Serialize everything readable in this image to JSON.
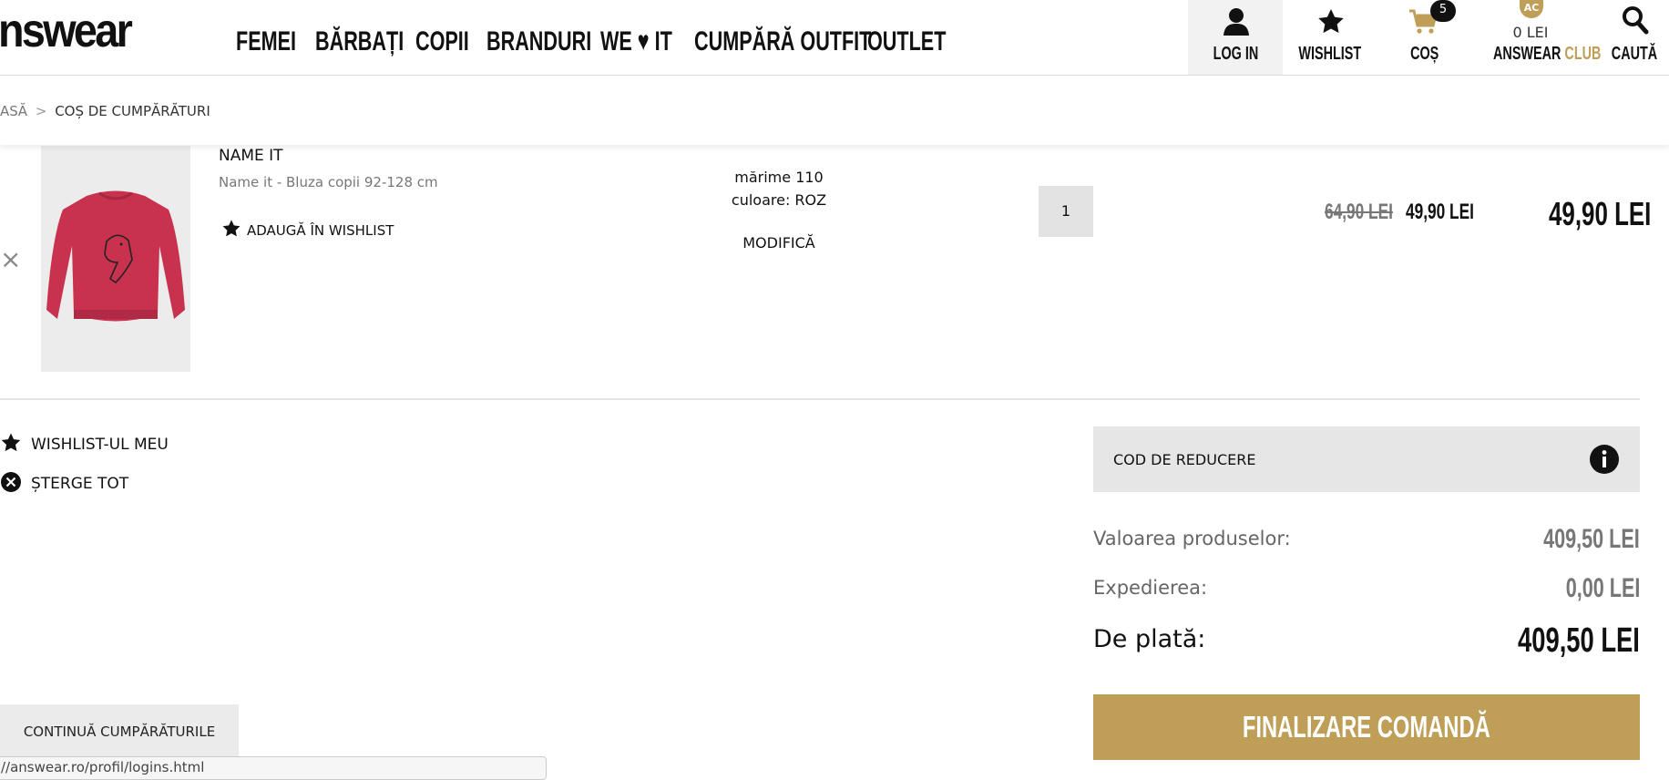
{
  "header": {
    "logo": "nswear",
    "nav": [
      "FEMEI",
      "BĂRBAȚI",
      "COPII",
      "BRANDURI",
      "WE ♥ IT",
      "CUMPĂRĂ OUTFIT",
      "OUTLET"
    ],
    "login_label": "LOG IN",
    "wishlist_label": "WISHLIST",
    "cart_label": "COȘ",
    "cart_count": "5",
    "club_badge": "AC",
    "club_amount": "0 LEI",
    "club_label_1": "ANSWEAR",
    "club_label_2": "CLUB",
    "search_label": "CAUTĂ"
  },
  "breadcrumb": {
    "home": "ASĂ",
    "separator": ">",
    "current": "COȘ DE CUMPĂRĂTURI"
  },
  "cart_item": {
    "brand": "NAME IT",
    "title": "Name it - Bluza copii 92-128 cm",
    "add_wishlist": "ADAUGĂ ÎN WISHLIST",
    "size": "mărime 110",
    "color": "culoare: ROZ",
    "modify": "MODIFICĂ",
    "quantity": "1",
    "old_price": "64,90 LEI",
    "price": "49,90 LEI",
    "total": "49,90 LEI",
    "remove_symbol": "×"
  },
  "actions": {
    "my_wishlist": "WISHLIST-UL MEU",
    "delete_all": "ȘTERGE TOT",
    "continue_shopping": "CONTINUĂ CUMPĂRĂTURILE"
  },
  "summary": {
    "coupon_label": "COD DE REDUCERE",
    "products_label": "Valoarea produselor:",
    "products_value": "409,50 LEI",
    "shipping_label": "Expedierea:",
    "shipping_value": "0,00 LEI",
    "total_label": "De plată:",
    "total_value": "409,50 LEI",
    "checkout_label": "FINALIZARE COMANDĂ"
  },
  "status_url": "//answear.ro/profil/logins.html",
  "colors": {
    "accent_gold": "#bf9e58",
    "product_red": "#c8324e",
    "text": "#111111"
  }
}
